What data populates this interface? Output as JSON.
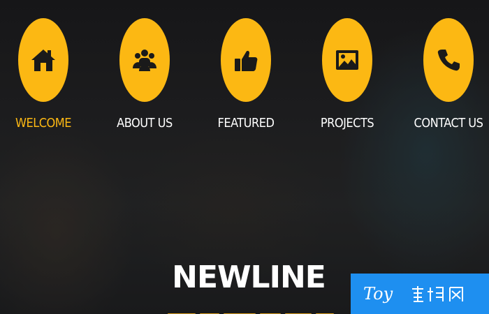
{
  "nav": {
    "accent_color": "#fcb813",
    "items": [
      {
        "label": "WELCOME",
        "icon": "home-icon",
        "active": true
      },
      {
        "label": "ABOUT US",
        "icon": "users-icon",
        "active": false
      },
      {
        "label": "FEATURED",
        "icon": "thumbs-up-icon",
        "active": false
      },
      {
        "label": "PROJECTS",
        "icon": "image-icon",
        "active": false
      },
      {
        "label": "CONTACT US",
        "icon": "phone-icon",
        "active": false
      }
    ]
  },
  "hero": {
    "title": "NEWLINE"
  },
  "watermark": {
    "text": "Toy 模板网",
    "color": "#1e8ff0"
  }
}
